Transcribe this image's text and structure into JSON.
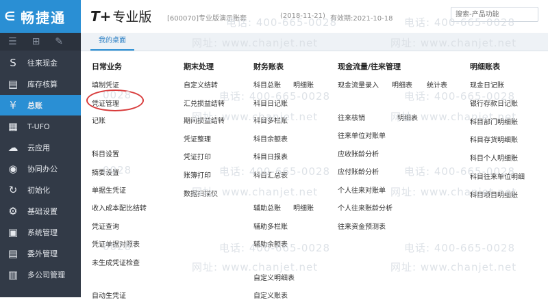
{
  "sidebar": {
    "logo": "畅捷通",
    "items": [
      {
        "label": "往来现金",
        "icon": "S"
      },
      {
        "label": "库存核算",
        "icon": "▤"
      },
      {
        "label": "总账",
        "icon": "¥"
      },
      {
        "label": "T-UFO",
        "icon": "▦"
      },
      {
        "label": "云应用",
        "icon": "☁"
      },
      {
        "label": "协同办公",
        "icon": "◉"
      },
      {
        "label": "初始化",
        "icon": "↻"
      },
      {
        "label": "基础设置",
        "icon": "⚙"
      },
      {
        "label": "系统管理",
        "icon": "▣"
      },
      {
        "label": "委外管理",
        "icon": "▤"
      },
      {
        "label": "多公司管理",
        "icon": "▥"
      }
    ]
  },
  "header": {
    "brand": "T+",
    "brand_sub": "专业版",
    "account": "[600070]专业版演示账套",
    "date": "(2018-11-21)",
    "valid": "有效期:2021-10-18",
    "search_placeholder": "搜索-产品功能"
  },
  "tab": {
    "label": "我的桌面"
  },
  "columns": [
    {
      "title": "日常业务",
      "links": [
        "填制凭证",
        "凭证管理",
        "记账",
        "科目设置",
        "摘要设置",
        "单据生凭证",
        "收入成本配比结转",
        "凭证查询",
        "凭证单据对照表",
        "未生成凭证检查",
        "自动生凭证"
      ]
    },
    {
      "title": "期末处理",
      "links": [
        "自定义结转",
        "汇兑损益结转",
        "期间损益结转",
        "凭证整理",
        "凭证打印",
        "账簿打印",
        "数据扫描仪"
      ]
    },
    {
      "title": "财务账表",
      "links": [
        "科目总账",
        "明细账",
        "科目日记账",
        "科目多栏账",
        "科目余额表",
        "科目日报表",
        "科目汇总表",
        "辅助总账",
        "明细账",
        "辅助多栏账",
        "辅助余额表",
        "自定义明细表",
        "自定义账表"
      ]
    },
    {
      "title": "现金流量/往来管理",
      "links": [
        "现金流量录入",
        "明细表",
        "统计表",
        "往来核销",
        "明细表",
        "往来单位对账单",
        "应收账龄分析",
        "应付账龄分析",
        "个人往来对账单",
        "个人往来账龄分析",
        "往来资金预测表"
      ]
    },
    {
      "title": "明细账表",
      "links": [
        "现金日记账",
        "银行存款日记账",
        "科目部门明细账",
        "科目存货明细账",
        "科目个人明细账",
        "科目往来单位明细",
        "科目项目明细账"
      ]
    }
  ],
  "watermark": {
    "phone": "电话: 400-665-0028",
    "site": "网址: www.chanjet.net",
    "code": "0028"
  }
}
